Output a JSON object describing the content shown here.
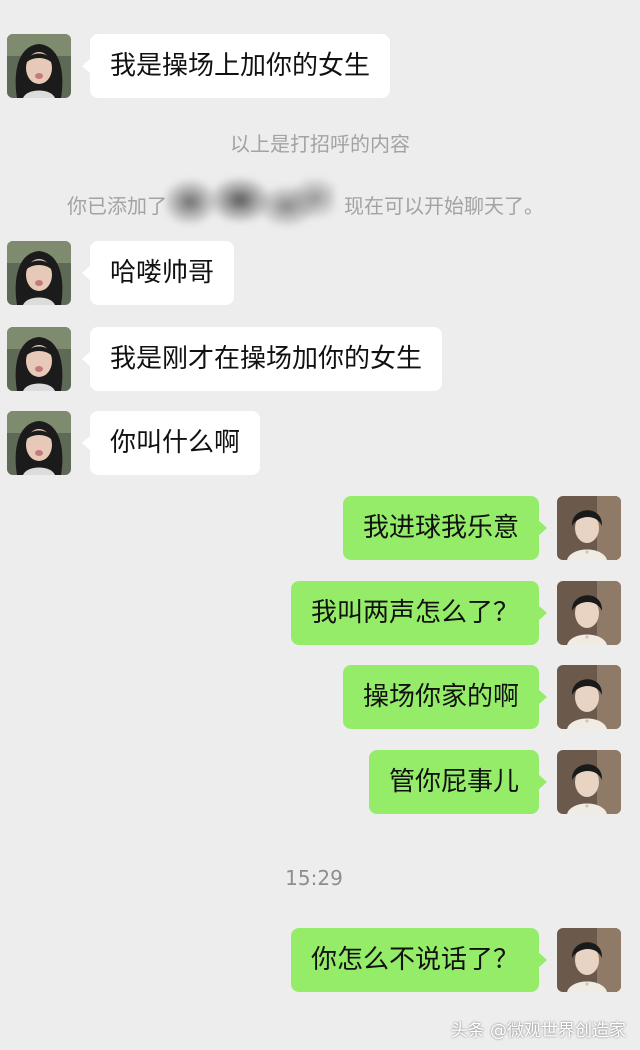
{
  "messages": [
    {
      "side": "in",
      "text": "我是操场上加你的女生"
    },
    {
      "side": "in",
      "text": "哈喽帅哥"
    },
    {
      "side": "in",
      "text": "我是刚才在操场加你的女生"
    },
    {
      "side": "in",
      "text": "你叫什么啊"
    },
    {
      "side": "out",
      "text": "我进球我乐意"
    },
    {
      "side": "out",
      "text": "我叫两声怎么了？"
    },
    {
      "side": "out",
      "text": "操场你家的啊"
    },
    {
      "side": "out",
      "text": "管你屁事儿"
    },
    {
      "side": "out",
      "text": "你怎么不说话了？"
    }
  ],
  "system": {
    "greeting_notice": "以上是打招呼的内容",
    "added_prefix": "你已添加了",
    "added_suffix": "现在可以开始聊天了。"
  },
  "timestamp": "15:29",
  "watermark": "头条 @微观世界创造家",
  "colors": {
    "background": "#ededed",
    "incoming_bubble": "#ffffff",
    "outgoing_bubble": "#95ec69"
  },
  "icons": {
    "incoming_avatar": "girl-avatar-icon",
    "outgoing_avatar": "boy-avatar-icon"
  }
}
